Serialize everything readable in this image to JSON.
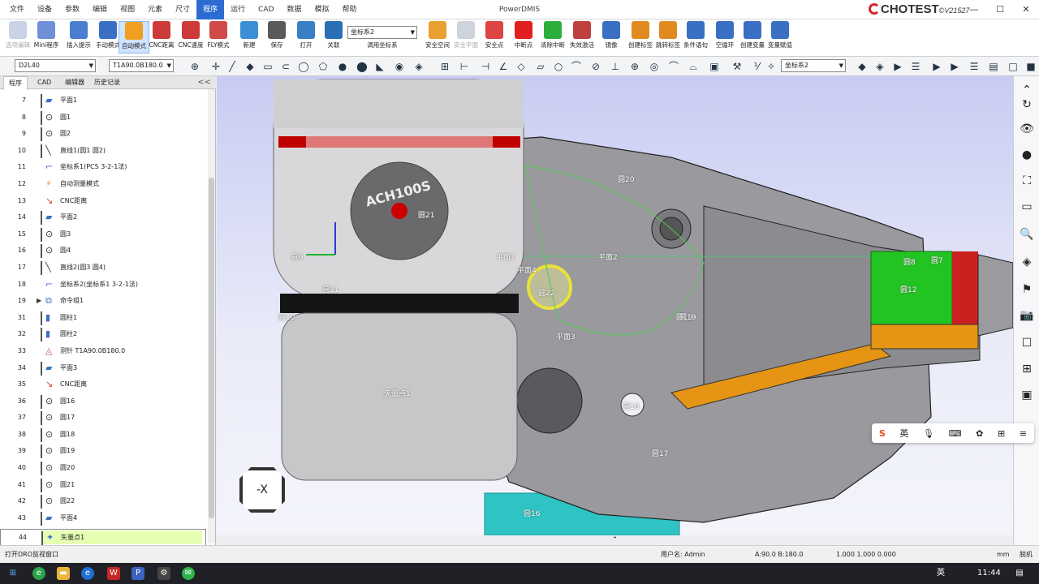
{
  "app": {
    "title": "PowerDMIS",
    "brand": "CHOTEST",
    "version": "V21527"
  },
  "menus": [
    "文件",
    "设备",
    "参数",
    "编辑",
    "视图",
    "元素",
    "尺寸",
    "程序",
    "运行",
    "CAD",
    "数据",
    "模拟",
    "帮助"
  ],
  "active_menu": "程序",
  "ribbon": [
    {
      "label": "选项编辑",
      "icon": "edit-options-icon",
      "dim": true
    },
    {
      "label": "Mini程序",
      "icon": "mini-program-icon"
    },
    {
      "label": "插入提示",
      "icon": "insert-hint-icon"
    },
    {
      "label": "手动模式",
      "icon": "hand-mode-icon"
    },
    {
      "label": "自动模式",
      "icon": "cnc-auto-icon",
      "active": true
    },
    {
      "label": "CNC距离",
      "icon": "cnc-distance-icon"
    },
    {
      "label": "CNC速度",
      "icon": "cnc-speed-icon"
    },
    {
      "label": "FLY模式",
      "icon": "fly-mode-icon"
    },
    {
      "label": "新建",
      "icon": "new-icon"
    },
    {
      "label": "保存",
      "icon": "save-icon"
    },
    {
      "label": "打开",
      "icon": "open-icon"
    },
    {
      "label": "关联",
      "icon": "link-icon"
    },
    {
      "label": "调用坐标系",
      "icon": "call-coordinate-icon"
    },
    {
      "label": "安全空间",
      "icon": "safe-space-icon"
    },
    {
      "label": "安全平面",
      "icon": "safe-plane-icon",
      "dim": true
    },
    {
      "label": "安全点",
      "icon": "safe-point-icon"
    },
    {
      "label": "中断点",
      "icon": "stop-point-icon"
    },
    {
      "label": "清除中断",
      "icon": "clear-stop-icon"
    },
    {
      "label": "失效激活",
      "icon": "disable-enable-icon"
    },
    {
      "label": "镜像",
      "icon": "mirror-icon"
    },
    {
      "label": "创建标签",
      "icon": "create-label-icon"
    },
    {
      "label": "跳转标签",
      "icon": "jump-label-icon"
    },
    {
      "label": "条件语句",
      "icon": "condition-icon"
    },
    {
      "label": "空循环",
      "icon": "loop-icon"
    },
    {
      "label": "创建变量",
      "icon": "create-variable-icon"
    },
    {
      "label": "变量赋值",
      "icon": "assign-variable-icon"
    }
  ],
  "ribbon_coord_select": "坐标系2",
  "toolbar2": {
    "probe": "D2L40",
    "tip": "T1A90.0B180.0",
    "coord": "坐标系2"
  },
  "panel": {
    "tabs": [
      "程序",
      "CAD",
      "编辑器",
      "历史记录"
    ],
    "collapse": "<<"
  },
  "tree": [
    {
      "n": "7",
      "label": "平面1",
      "icon": "plane-icon",
      "bar": true
    },
    {
      "n": "8",
      "label": "圆1",
      "icon": "circle-icon",
      "bar": true
    },
    {
      "n": "9",
      "label": "圆2",
      "icon": "circle-icon",
      "bar": true
    },
    {
      "n": "10",
      "label": "直线1(圆1 圆2)",
      "icon": "line-icon",
      "bar": true
    },
    {
      "n": "11",
      "label": "坐标系1(PCS  3-2-1法)",
      "icon": "coordinate-icon"
    },
    {
      "n": "12",
      "label": "自动测量模式",
      "icon": "cnc-icon"
    },
    {
      "n": "13",
      "label": "CNC距离",
      "icon": "cnc-distance-icon"
    },
    {
      "n": "14",
      "label": "平面2",
      "icon": "plane-icon",
      "bar": true
    },
    {
      "n": "15",
      "label": "圆3",
      "icon": "circle-icon",
      "bar": true
    },
    {
      "n": "16",
      "label": "圆4",
      "icon": "circle-icon",
      "bar": true
    },
    {
      "n": "17",
      "label": "直线2(圆3 圆4)",
      "icon": "line-icon",
      "bar": true
    },
    {
      "n": "18",
      "label": "坐标系2(坐标系1  3-2-1法)",
      "icon": "coordinate-icon"
    },
    {
      "n": "19",
      "label": "命令组1",
      "icon": "group-icon",
      "expand": true
    },
    {
      "n": "31",
      "label": "圆柱1",
      "icon": "cylinder-icon",
      "bar": true
    },
    {
      "n": "32",
      "label": "圆柱2",
      "icon": "cylinder-icon",
      "bar": true
    },
    {
      "n": "33",
      "label": "测针 T1A90.0B180.0",
      "icon": "probe-icon"
    },
    {
      "n": "34",
      "label": "平面3",
      "icon": "plane-icon",
      "bar": true
    },
    {
      "n": "35",
      "label": "CNC距离",
      "icon": "cnc-distance-icon"
    },
    {
      "n": "36",
      "label": "圆16",
      "icon": "circle-icon",
      "bar": true
    },
    {
      "n": "37",
      "label": "圆17",
      "icon": "circle-icon",
      "bar": true
    },
    {
      "n": "38",
      "label": "圆18",
      "icon": "circle-icon",
      "bar": true
    },
    {
      "n": "39",
      "label": "圆19",
      "icon": "circle-icon",
      "bar": true
    },
    {
      "n": "40",
      "label": "圆20",
      "icon": "circle-icon",
      "bar": true
    },
    {
      "n": "41",
      "label": "圆21",
      "icon": "circle-icon",
      "bar": true
    },
    {
      "n": "42",
      "label": "圆22",
      "icon": "circle-icon",
      "bar": true
    },
    {
      "n": "43",
      "label": "平面4",
      "icon": "plane-icon",
      "bar": true
    },
    {
      "n": "44",
      "label": "矢量点1",
      "icon": "vector-point-icon",
      "bar": true,
      "selected": true
    }
  ],
  "viewport": {
    "probe_text": "ACH100S",
    "view_dir": "-X",
    "labels": [
      "圆20",
      "圆21",
      "圆19",
      "圆9",
      "平面1",
      "平面2",
      "平面4",
      "圆22",
      "圆11",
      "圆10",
      "平面3",
      "圆19",
      "矢量点1",
      "圆18",
      "圆17",
      "圆16",
      "圆7",
      "圆8",
      "圆12"
    ]
  },
  "statusbar": {
    "hint": "打开DRO监视窗口",
    "user": "用户名: Admin",
    "angles": "A:90.0  B:180.0",
    "scale": "1.000  1.000  0.000",
    "unit": "mm",
    "mode": "脱机"
  },
  "taskbar": {
    "time": "11:44",
    "ime": "英",
    "tray_ime": "英"
  }
}
